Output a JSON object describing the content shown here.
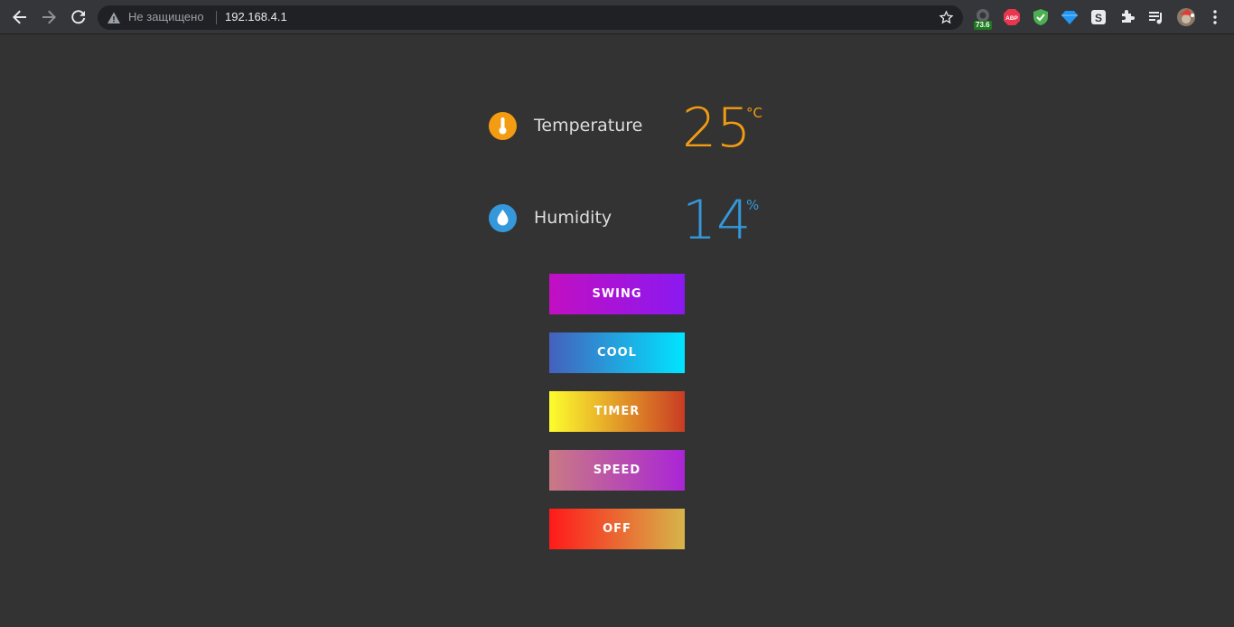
{
  "browser": {
    "security_text": "Не защищено",
    "url": "192.168.4.1",
    "extension_badge": "73.6",
    "icons": [
      "back-icon",
      "forward-icon",
      "reload-icon",
      "warning-icon",
      "star-icon",
      "extension-icon",
      "adblock-icon",
      "shield-icon",
      "diamond-icon",
      "s-icon",
      "puzzle-icon",
      "media-icon",
      "profile-avatar",
      "menu-icon"
    ]
  },
  "sensors": {
    "temperature": {
      "label": "Temperature",
      "value": "25",
      "unit": "°C",
      "color": "#f39c12",
      "icon": "thermometer-icon"
    },
    "humidity": {
      "label": "Humidity",
      "value": "14",
      "unit": "%",
      "color": "#3498db",
      "icon": "water-drop-icon"
    }
  },
  "controls": [
    {
      "label": "SWING",
      "gradient": [
        "#c20fc2",
        "#8a19f0"
      ]
    },
    {
      "label": "COOL",
      "gradient": [
        "#4560bd",
        "#00e5ff"
      ]
    },
    {
      "label": "TIMER",
      "gradient": [
        "#fdfd2e",
        "#c93c23"
      ]
    },
    {
      "label": "SPEED",
      "gradient": [
        "#c97a84",
        "#aa25d6"
      ]
    },
    {
      "label": "OFF",
      "gradient": [
        "#ff1a1a",
        "#d6b54a"
      ]
    }
  ]
}
